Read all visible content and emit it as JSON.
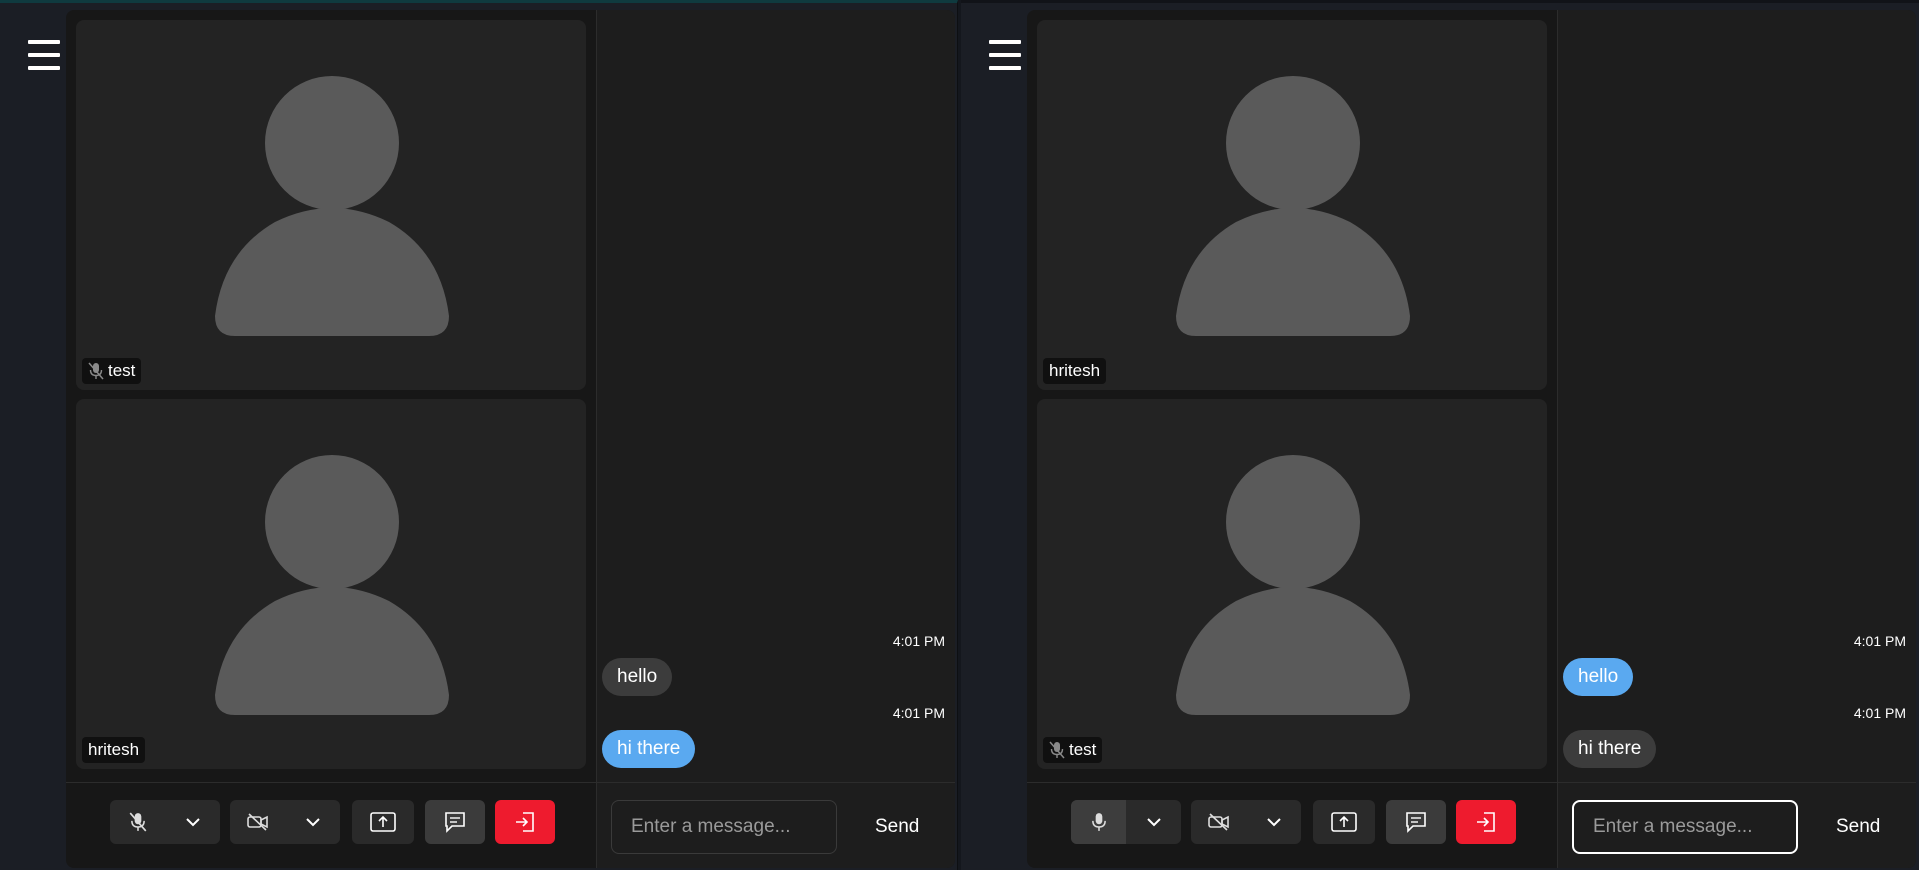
{
  "icons": {
    "menu": "hamburger-menu-icon",
    "avatar": "person-silhouette-icon",
    "mic_muted": "mic-off-icon",
    "mic": "mic-icon",
    "chevron": "chevron-down-icon",
    "video_off": "video-off-icon",
    "share": "share-screen-icon",
    "chat": "chat-icon",
    "leave": "leave-icon"
  },
  "colors": {
    "self_bubble": "#5aa9f0",
    "other_bubble": "#3c3c3c",
    "leave_button": "#ee1b2e"
  },
  "left_window": {
    "tiles": [
      {
        "name": "test",
        "muted": true
      },
      {
        "name": "hritesh",
        "muted": false
      }
    ],
    "messages": [
      {
        "time": "4:01 PM",
        "text": "hello",
        "mine": false
      },
      {
        "time": "4:01 PM",
        "text": "hi there",
        "mine": true
      }
    ],
    "chat_input": {
      "placeholder": "Enter a message...",
      "value": ""
    },
    "send_label": "Send",
    "mic_state": "muted"
  },
  "right_window": {
    "tiles": [
      {
        "name": "hritesh",
        "muted": false
      },
      {
        "name": "test",
        "muted": true
      }
    ],
    "messages": [
      {
        "time": "4:01 PM",
        "text": "hello",
        "mine": true
      },
      {
        "time": "4:01 PM",
        "text": "hi there",
        "mine": false
      }
    ],
    "chat_input": {
      "placeholder": "Enter a message...",
      "value": ""
    },
    "send_label": "Send",
    "mic_state": "on"
  }
}
